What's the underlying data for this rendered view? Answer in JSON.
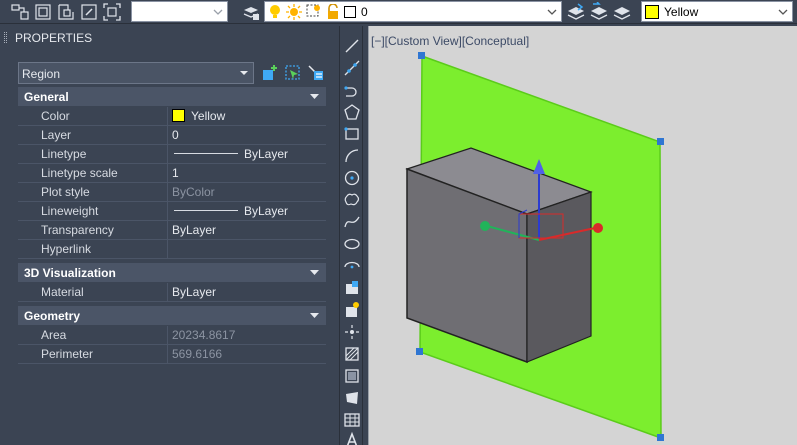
{
  "toolbar": {
    "layer_combo_value": "",
    "layer_name": "0",
    "color_name": "Yellow",
    "accent_yellow": "#ffff00"
  },
  "palette": {
    "title": "PROPERTIES",
    "selection": "Region",
    "categories": {
      "general": "General",
      "visualization": "3D Visualization",
      "geometry": "Geometry"
    },
    "general": {
      "color_label": "Color",
      "color_value": "Yellow",
      "layer_label": "Layer",
      "layer_value": "0",
      "linetype_label": "Linetype",
      "linetype_value": "ByLayer",
      "ltscale_label": "Linetype scale",
      "ltscale_value": "1",
      "plotstyle_label": "Plot style",
      "plotstyle_value": "ByColor",
      "lineweight_label": "Lineweight",
      "lineweight_value": "ByLayer",
      "transparency_label": "Transparency",
      "transparency_value": "ByLayer",
      "hyperlink_label": "Hyperlink",
      "hyperlink_value": ""
    },
    "visualization": {
      "material_label": "Material",
      "material_value": "ByLayer"
    },
    "geometry": {
      "area_label": "Area",
      "area_value": "20234.8617",
      "perimeter_label": "Perimeter",
      "perimeter_value": "569.6166"
    }
  },
  "viewport": {
    "label": "[−][Custom View][Conceptual]",
    "region_color": "#7cee2e",
    "box_color": "#6f6e73"
  }
}
